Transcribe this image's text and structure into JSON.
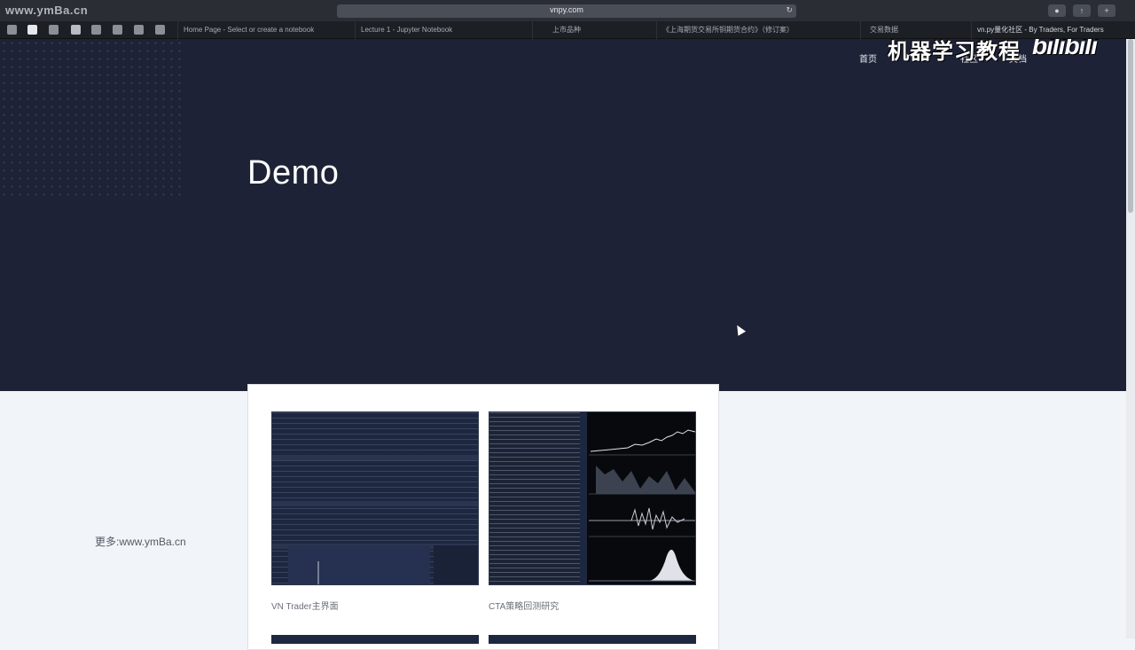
{
  "browser": {
    "watermark": "www.ymBa.cn",
    "url": "vnpy.com",
    "tabs": [
      "Home Page - Select or create a notebook",
      "Lecture 1 - Jupyter Notebook",
      "上市品种",
      "《上海期货交易所铜期货合约》（修订案）",
      "交易数据",
      "vn.py量化社区 - By Traders, For Traders"
    ]
  },
  "nav": {
    "items": [
      "首页",
      "vn.py",
      "社区",
      "文档"
    ]
  },
  "overlay": {
    "channel_title": "机器学习教程",
    "logo_text": "bilibili"
  },
  "hero": {
    "title": "Demo"
  },
  "side": {
    "watermark": "更多:www.ymBa.cn"
  },
  "demos": [
    {
      "caption": "VN Trader主界面"
    },
    {
      "caption": "CTA策略回测研究"
    }
  ]
}
